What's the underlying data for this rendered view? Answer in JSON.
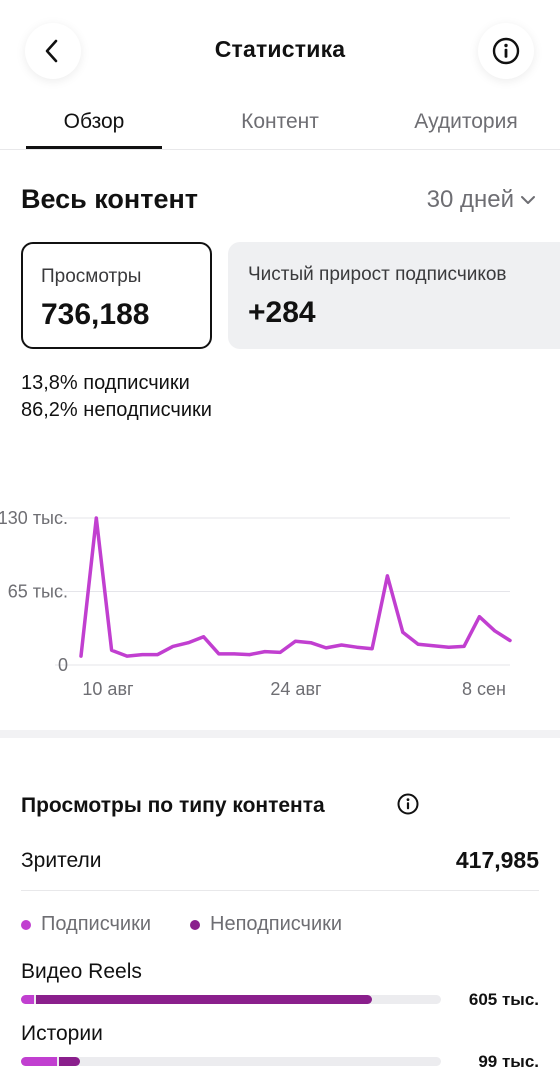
{
  "header": {
    "title": "Статистика"
  },
  "tabs": [
    {
      "label": "Обзор",
      "active": true
    },
    {
      "label": "Контент",
      "active": false
    },
    {
      "label": "Аудитория",
      "active": false
    }
  ],
  "overview": {
    "section_title": "Весь контент",
    "period": "30 дней",
    "cards": [
      {
        "label": "Просмотры",
        "value": "736,188",
        "selected": true
      },
      {
        "label": "Чистый прирост подписчиков",
        "value": "+284",
        "selected": false
      }
    ],
    "followers_pct": "13,8%",
    "followers_label": "подписчики",
    "nonfollowers_pct": "86,2%",
    "nonfollowers_label": "неподписчики"
  },
  "chart_data": {
    "type": "line",
    "series": [
      {
        "color": "#c13fd0",
        "values": [
          12,
          198,
          20,
          12,
          14,
          14,
          25,
          30,
          38,
          15,
          15,
          14,
          18,
          17,
          32,
          30,
          23,
          27,
          24,
          22,
          120,
          44,
          28,
          26,
          24,
          25,
          65,
          46,
          33
        ]
      }
    ],
    "x_ticks": [
      "10 авг",
      "24 авг",
      "8 сен"
    ],
    "y_ticks": [
      "0",
      "65 тыс.",
      "130 тыс."
    ],
    "ylim": [
      0,
      198
    ],
    "grid": true
  },
  "content_type": {
    "title": "Просмотры по типу контента",
    "viewers_label": "Зрители",
    "viewers_value": "417,985",
    "legend": [
      {
        "label": "Подписчики",
        "color": "#c13fd0"
      },
      {
        "label": "Неподписчики",
        "color": "#8a1f8c"
      }
    ],
    "bars": [
      {
        "label": "Видео Reels",
        "value": "605 тыс.",
        "followers_fraction": 0.03,
        "nonfollowers_fraction": 0.8
      },
      {
        "label": "Истории",
        "value": "99 тыс.",
        "followers_fraction": 0.085,
        "nonfollowers_fraction": 0.05
      }
    ]
  }
}
